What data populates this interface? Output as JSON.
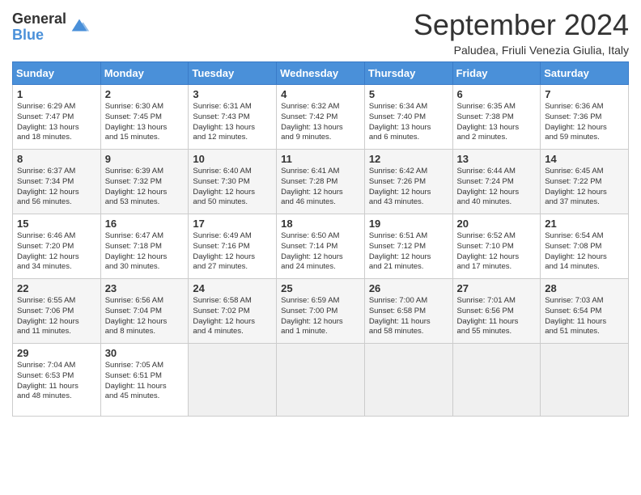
{
  "logo": {
    "general": "General",
    "blue": "Blue"
  },
  "title": "September 2024",
  "location": "Paludea, Friuli Venezia Giulia, Italy",
  "days_of_week": [
    "Sunday",
    "Monday",
    "Tuesday",
    "Wednesday",
    "Thursday",
    "Friday",
    "Saturday"
  ],
  "weeks": [
    [
      {
        "day": 1,
        "info": "Sunrise: 6:29 AM\nSunset: 7:47 PM\nDaylight: 13 hours\nand 18 minutes."
      },
      {
        "day": 2,
        "info": "Sunrise: 6:30 AM\nSunset: 7:45 PM\nDaylight: 13 hours\nand 15 minutes."
      },
      {
        "day": 3,
        "info": "Sunrise: 6:31 AM\nSunset: 7:43 PM\nDaylight: 13 hours\nand 12 minutes."
      },
      {
        "day": 4,
        "info": "Sunrise: 6:32 AM\nSunset: 7:42 PM\nDaylight: 13 hours\nand 9 minutes."
      },
      {
        "day": 5,
        "info": "Sunrise: 6:34 AM\nSunset: 7:40 PM\nDaylight: 13 hours\nand 6 minutes."
      },
      {
        "day": 6,
        "info": "Sunrise: 6:35 AM\nSunset: 7:38 PM\nDaylight: 13 hours\nand 2 minutes."
      },
      {
        "day": 7,
        "info": "Sunrise: 6:36 AM\nSunset: 7:36 PM\nDaylight: 12 hours\nand 59 minutes."
      }
    ],
    [
      {
        "day": 8,
        "info": "Sunrise: 6:37 AM\nSunset: 7:34 PM\nDaylight: 12 hours\nand 56 minutes."
      },
      {
        "day": 9,
        "info": "Sunrise: 6:39 AM\nSunset: 7:32 PM\nDaylight: 12 hours\nand 53 minutes."
      },
      {
        "day": 10,
        "info": "Sunrise: 6:40 AM\nSunset: 7:30 PM\nDaylight: 12 hours\nand 50 minutes."
      },
      {
        "day": 11,
        "info": "Sunrise: 6:41 AM\nSunset: 7:28 PM\nDaylight: 12 hours\nand 46 minutes."
      },
      {
        "day": 12,
        "info": "Sunrise: 6:42 AM\nSunset: 7:26 PM\nDaylight: 12 hours\nand 43 minutes."
      },
      {
        "day": 13,
        "info": "Sunrise: 6:44 AM\nSunset: 7:24 PM\nDaylight: 12 hours\nand 40 minutes."
      },
      {
        "day": 14,
        "info": "Sunrise: 6:45 AM\nSunset: 7:22 PM\nDaylight: 12 hours\nand 37 minutes."
      }
    ],
    [
      {
        "day": 15,
        "info": "Sunrise: 6:46 AM\nSunset: 7:20 PM\nDaylight: 12 hours\nand 34 minutes."
      },
      {
        "day": 16,
        "info": "Sunrise: 6:47 AM\nSunset: 7:18 PM\nDaylight: 12 hours\nand 30 minutes."
      },
      {
        "day": 17,
        "info": "Sunrise: 6:49 AM\nSunset: 7:16 PM\nDaylight: 12 hours\nand 27 minutes."
      },
      {
        "day": 18,
        "info": "Sunrise: 6:50 AM\nSunset: 7:14 PM\nDaylight: 12 hours\nand 24 minutes."
      },
      {
        "day": 19,
        "info": "Sunrise: 6:51 AM\nSunset: 7:12 PM\nDaylight: 12 hours\nand 21 minutes."
      },
      {
        "day": 20,
        "info": "Sunrise: 6:52 AM\nSunset: 7:10 PM\nDaylight: 12 hours\nand 17 minutes."
      },
      {
        "day": 21,
        "info": "Sunrise: 6:54 AM\nSunset: 7:08 PM\nDaylight: 12 hours\nand 14 minutes."
      }
    ],
    [
      {
        "day": 22,
        "info": "Sunrise: 6:55 AM\nSunset: 7:06 PM\nDaylight: 12 hours\nand 11 minutes."
      },
      {
        "day": 23,
        "info": "Sunrise: 6:56 AM\nSunset: 7:04 PM\nDaylight: 12 hours\nand 8 minutes."
      },
      {
        "day": 24,
        "info": "Sunrise: 6:58 AM\nSunset: 7:02 PM\nDaylight: 12 hours\nand 4 minutes."
      },
      {
        "day": 25,
        "info": "Sunrise: 6:59 AM\nSunset: 7:00 PM\nDaylight: 12 hours\nand 1 minute."
      },
      {
        "day": 26,
        "info": "Sunrise: 7:00 AM\nSunset: 6:58 PM\nDaylight: 11 hours\nand 58 minutes."
      },
      {
        "day": 27,
        "info": "Sunrise: 7:01 AM\nSunset: 6:56 PM\nDaylight: 11 hours\nand 55 minutes."
      },
      {
        "day": 28,
        "info": "Sunrise: 7:03 AM\nSunset: 6:54 PM\nDaylight: 11 hours\nand 51 minutes."
      }
    ],
    [
      {
        "day": 29,
        "info": "Sunrise: 7:04 AM\nSunset: 6:53 PM\nDaylight: 11 hours\nand 48 minutes."
      },
      {
        "day": 30,
        "info": "Sunrise: 7:05 AM\nSunset: 6:51 PM\nDaylight: 11 hours\nand 45 minutes."
      },
      null,
      null,
      null,
      null,
      null
    ]
  ]
}
